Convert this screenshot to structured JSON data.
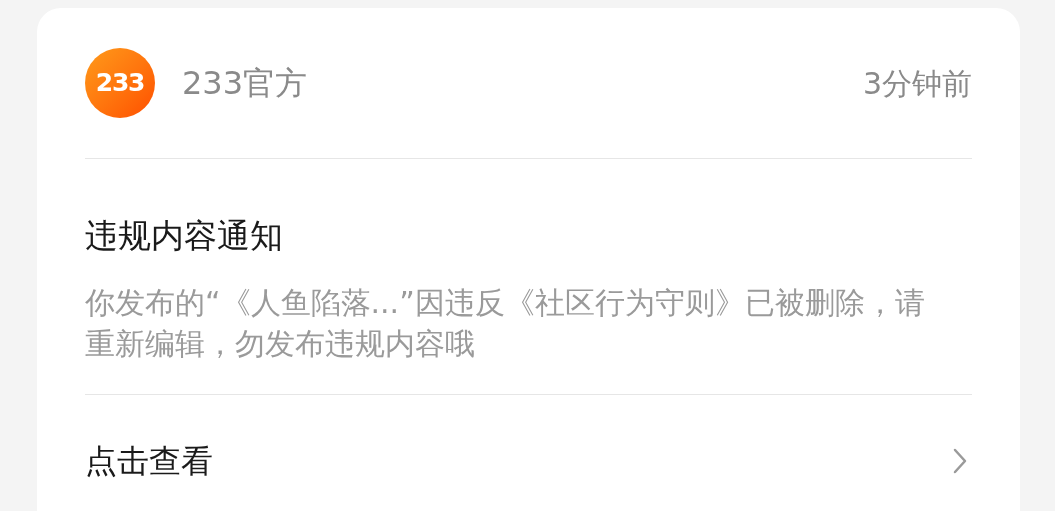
{
  "header": {
    "logo_text": "233",
    "sender": "233官方",
    "time": "3分钟前"
  },
  "notice": {
    "title": "违规内容通知",
    "body": "你发布的“《人鱼陷落...”因违反《社区行为守则》已被删除，请重新编辑，勿发布违规内容哦"
  },
  "action": {
    "label": "点击查看"
  }
}
